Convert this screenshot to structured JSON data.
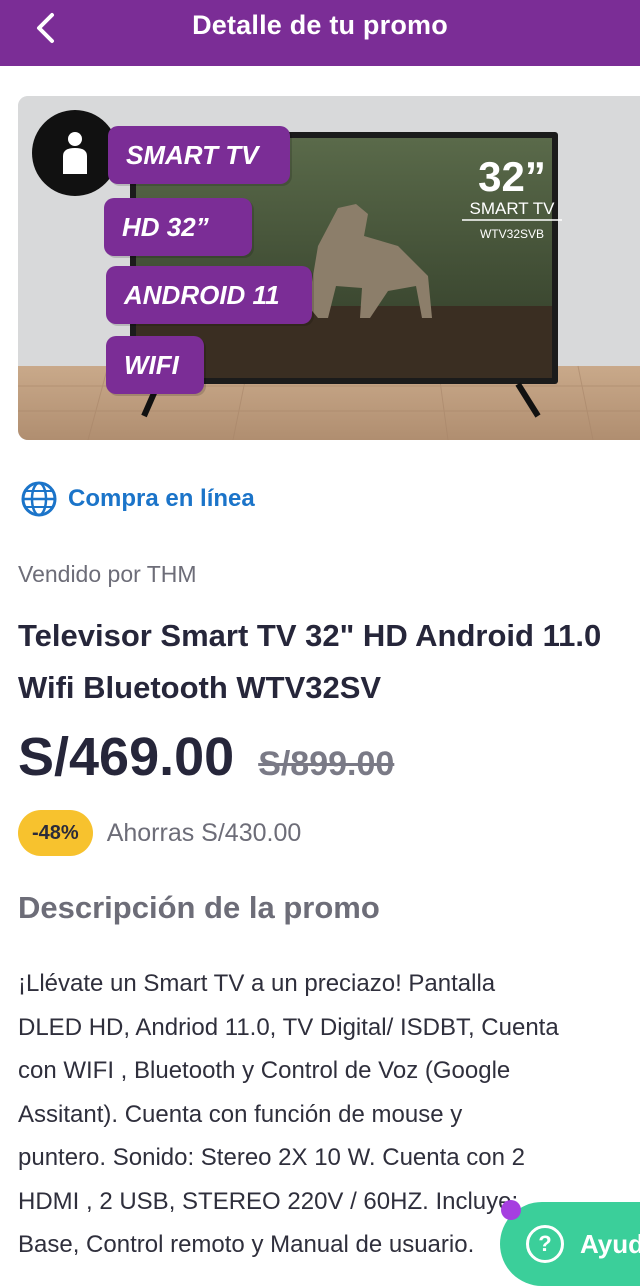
{
  "header": {
    "title": "Detalle de tu promo"
  },
  "banner": {
    "chips": [
      "SMART TV",
      "HD 32”",
      "ANDROID 11",
      "WIFI"
    ],
    "tv_size": "32”",
    "tv_label": "SMART TV",
    "tv_model": "WTV32SVB"
  },
  "purchase_type": {
    "label": "Compra en línea"
  },
  "product": {
    "seller": "Vendido por THM",
    "title_line1": "Televisor Smart TV 32\" HD Android 11.0",
    "title_line2": "Wifi Bluetooth WTV32SV",
    "price": "S/469.00",
    "old_price": "S/899.00",
    "discount": "-48%",
    "savings": "Ahorras S/430.00"
  },
  "description": {
    "title": "Descripción de la promo",
    "lines": [
      "¡Llévate un Smart TV a un preciazo! Pantalla",
      "DLED HD, Andriod 11.0, TV Digital/ ISDBT, Cuenta",
      "con WIFI , Bluetooth y Control de Voz (Google",
      "Assitant). Cuenta con función de mouse y",
      "puntero. Sonido: Stereo 2X 10 W. Cuenta con 2",
      "HDMI , 2 USB, STEREO 220V / 60HZ. Incluye:",
      "Base, Control remoto y Manual de usuario."
    ]
  },
  "help_button": {
    "label": "Ayuda"
  },
  "colors": {
    "brand_purple": "#7b2d96",
    "accent_green": "#3bcf9a",
    "discount_yellow": "#f7c22e",
    "link_blue": "#1b74c9"
  }
}
